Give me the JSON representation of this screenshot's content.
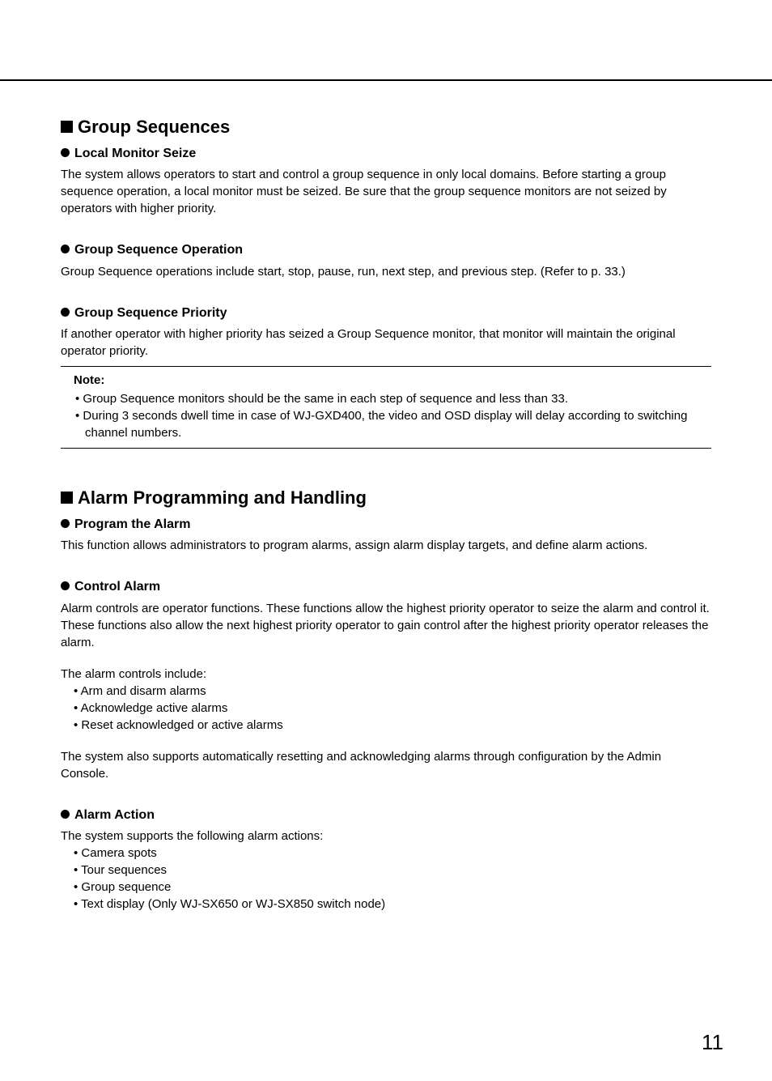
{
  "page_number": "11",
  "section1": {
    "heading": "Group Sequences",
    "sub1": {
      "title": "Local Monitor Seize",
      "body": "The system allows operators to start and control a group sequence in only local domains. Before starting a group sequence operation, a local monitor must be seized. Be sure that the group sequence monitors are not seized by operators with higher priority."
    },
    "sub2": {
      "title": "Group Sequence Operation",
      "body": "Group Sequence operations include start, stop, pause, run, next step, and previous step. (Refer to p. 33.)"
    },
    "sub3": {
      "title": "Group Sequence Priority",
      "body": "If another operator with higher priority has seized a Group Sequence monitor, that monitor will maintain the original operator priority."
    },
    "note": {
      "label": "Note:",
      "items": [
        "Group Sequence monitors should be the same in each step of sequence and less than 33.",
        "During 3 seconds dwell time in case of WJ-GXD400, the video and OSD display will delay according to switching channel numbers."
      ]
    }
  },
  "section2": {
    "heading": "Alarm Programming and Handling",
    "sub1": {
      "title": "Program the Alarm",
      "body": "This function allows administrators to program alarms, assign alarm display targets, and define alarm actions."
    },
    "sub2": {
      "title": "Control Alarm",
      "body1": "Alarm controls are operator functions. These functions allow the highest priority operator to seize the alarm and control it. These functions also allow the next highest priority operator to gain control after the highest priority operator releases the alarm.",
      "body2": "The alarm controls include:",
      "items": [
        "Arm and disarm alarms",
        "Acknowledge active alarms",
        "Reset acknowledged or active alarms"
      ],
      "body3": "The system also supports automatically resetting and acknowledging alarms through configuration by the Admin Console."
    },
    "sub3": {
      "title": "Alarm Action",
      "body": "The system supports the following alarm actions:",
      "items": [
        "Camera spots",
        "Tour sequences",
        "Group sequence",
        "Text display (Only WJ-SX650 or WJ-SX850 switch node)"
      ]
    }
  }
}
